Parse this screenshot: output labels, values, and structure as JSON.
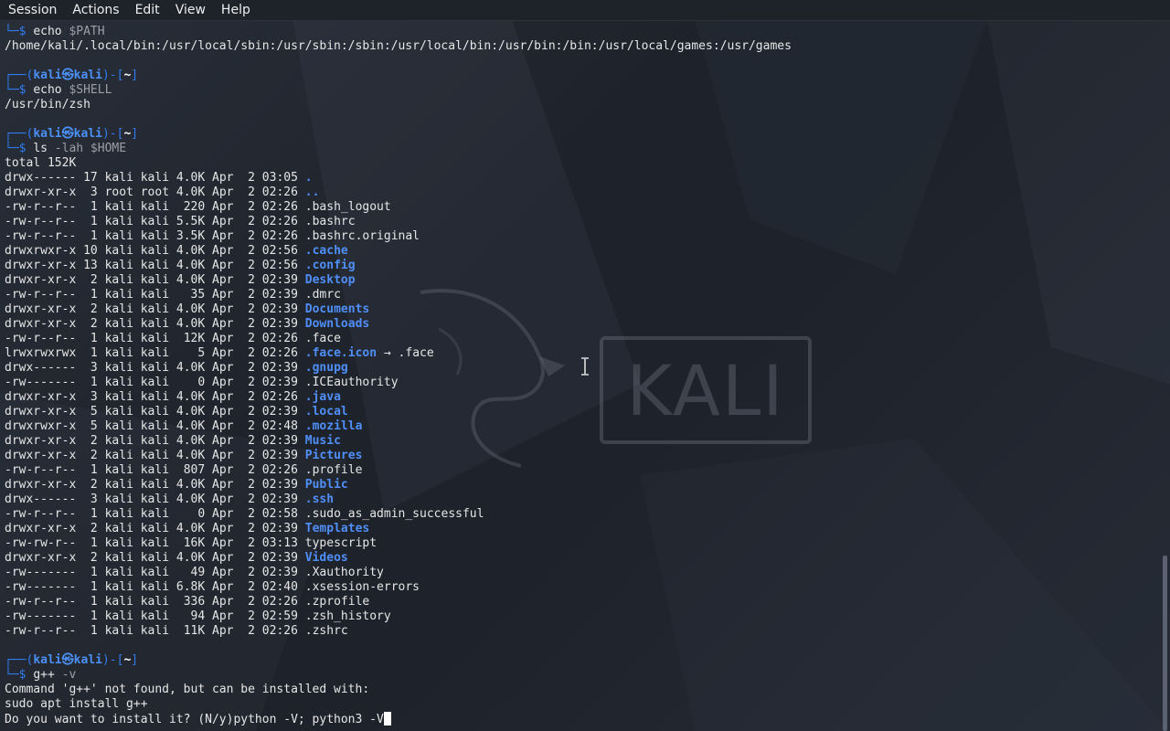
{
  "menubar": {
    "items": [
      "Session",
      "Actions",
      "Edit",
      "View",
      "Help"
    ]
  },
  "background": {
    "logo_text": "KALI"
  },
  "terminal": {
    "prompt": {
      "user": "kali",
      "host": "kali",
      "dir": "~"
    },
    "lines": [
      {
        "kind": "cmdonly",
        "cmd": "echo",
        "args": " $PATH"
      },
      {
        "kind": "out",
        "text": "/home/kali/.local/bin:/usr/local/sbin:/usr/sbin:/sbin:/usr/local/bin:/usr/bin:/bin:/usr/local/games:/usr/games"
      },
      {
        "kind": "blank"
      },
      {
        "kind": "prompt"
      },
      {
        "kind": "cmdonly",
        "cmd": "echo",
        "args": " $SHELL"
      },
      {
        "kind": "out",
        "text": "/usr/bin/zsh"
      },
      {
        "kind": "blank"
      },
      {
        "kind": "prompt"
      },
      {
        "kind": "cmdonly",
        "cmd": "ls",
        "args": " -lah $HOME"
      },
      {
        "kind": "out",
        "text": "total 152K"
      },
      {
        "kind": "ls",
        "perm": "drwx------",
        "links": "17",
        "size": "4.0K",
        "time": "03:05",
        "name": ".",
        "isdir": true
      },
      {
        "kind": "ls",
        "perm": "drwxr-xr-x",
        "links": " 3",
        "owner": "root root",
        "size": "4.0K",
        "time": "02:26",
        "name": "..",
        "isdir": true
      },
      {
        "kind": "ls",
        "perm": "-rw-r--r--",
        "links": " 1",
        "size": " 220",
        "time": "02:26",
        "name": ".bash_logout",
        "isdir": false
      },
      {
        "kind": "ls",
        "perm": "-rw-r--r--",
        "links": " 1",
        "size": "5.5K",
        "time": "02:26",
        "name": ".bashrc",
        "isdir": false
      },
      {
        "kind": "ls",
        "perm": "-rw-r--r--",
        "links": " 1",
        "size": "3.5K",
        "time": "02:26",
        "name": ".bashrc.original",
        "isdir": false
      },
      {
        "kind": "ls",
        "perm": "drwxrwxr-x",
        "links": "10",
        "size": "4.0K",
        "time": "02:56",
        "name": ".cache",
        "isdir": true
      },
      {
        "kind": "ls",
        "perm": "drwxr-xr-x",
        "links": "13",
        "size": "4.0K",
        "time": "02:56",
        "name": ".config",
        "isdir": true
      },
      {
        "kind": "ls",
        "perm": "drwxr-xr-x",
        "links": " 2",
        "size": "4.0K",
        "time": "02:39",
        "name": "Desktop",
        "isdir": true
      },
      {
        "kind": "ls",
        "perm": "-rw-r--r--",
        "links": " 1",
        "size": "  35",
        "time": "02:39",
        "name": ".dmrc",
        "isdir": false
      },
      {
        "kind": "ls",
        "perm": "drwxr-xr-x",
        "links": " 2",
        "size": "4.0K",
        "time": "02:39",
        "name": "Documents",
        "isdir": true
      },
      {
        "kind": "ls",
        "perm": "drwxr-xr-x",
        "links": " 2",
        "size": "4.0K",
        "time": "02:39",
        "name": "Downloads",
        "isdir": true
      },
      {
        "kind": "ls",
        "perm": "-rw-r--r--",
        "links": " 1",
        "size": " 12K",
        "time": "02:26",
        "name": ".face",
        "isdir": false
      },
      {
        "kind": "ls",
        "perm": "lrwxrwxrwx",
        "links": " 1",
        "size": "   5",
        "time": "02:26",
        "name": ".face.icon",
        "isdir": true,
        "link": " → .face"
      },
      {
        "kind": "ls",
        "perm": "drwx------",
        "links": " 3",
        "size": "4.0K",
        "time": "02:39",
        "name": ".gnupg",
        "isdir": true
      },
      {
        "kind": "ls",
        "perm": "-rw-------",
        "links": " 1",
        "size": "   0",
        "time": "02:39",
        "name": ".ICEauthority",
        "isdir": false
      },
      {
        "kind": "ls",
        "perm": "drwxr-xr-x",
        "links": " 3",
        "size": "4.0K",
        "time": "02:26",
        "name": ".java",
        "isdir": true
      },
      {
        "kind": "ls",
        "perm": "drwxr-xr-x",
        "links": " 5",
        "size": "4.0K",
        "time": "02:39",
        "name": ".local",
        "isdir": true
      },
      {
        "kind": "ls",
        "perm": "drwxrwxr-x",
        "links": " 5",
        "size": "4.0K",
        "time": "02:48",
        "name": ".mozilla",
        "isdir": true
      },
      {
        "kind": "ls",
        "perm": "drwxr-xr-x",
        "links": " 2",
        "size": "4.0K",
        "time": "02:39",
        "name": "Music",
        "isdir": true
      },
      {
        "kind": "ls",
        "perm": "drwxr-xr-x",
        "links": " 2",
        "size": "4.0K",
        "time": "02:39",
        "name": "Pictures",
        "isdir": true
      },
      {
        "kind": "ls",
        "perm": "-rw-r--r--",
        "links": " 1",
        "size": " 807",
        "time": "02:26",
        "name": ".profile",
        "isdir": false
      },
      {
        "kind": "ls",
        "perm": "drwxr-xr-x",
        "links": " 2",
        "size": "4.0K",
        "time": "02:39",
        "name": "Public",
        "isdir": true
      },
      {
        "kind": "ls",
        "perm": "drwx------",
        "links": " 3",
        "size": "4.0K",
        "time": "02:39",
        "name": ".ssh",
        "isdir": true
      },
      {
        "kind": "ls",
        "perm": "-rw-r--r--",
        "links": " 1",
        "size": "   0",
        "time": "02:58",
        "name": ".sudo_as_admin_successful",
        "isdir": false
      },
      {
        "kind": "ls",
        "perm": "drwxr-xr-x",
        "links": " 2",
        "size": "4.0K",
        "time": "02:39",
        "name": "Templates",
        "isdir": true
      },
      {
        "kind": "ls",
        "perm": "-rw-rw-r--",
        "links": " 1",
        "size": " 16K",
        "time": "03:13",
        "name": "typescript",
        "isdir": false
      },
      {
        "kind": "ls",
        "perm": "drwxr-xr-x",
        "links": " 2",
        "size": "4.0K",
        "time": "02:39",
        "name": "Videos",
        "isdir": true
      },
      {
        "kind": "ls",
        "perm": "-rw-------",
        "links": " 1",
        "size": "  49",
        "time": "02:39",
        "name": ".Xauthority",
        "isdir": false
      },
      {
        "kind": "ls",
        "perm": "-rw-------",
        "links": " 1",
        "size": "6.8K",
        "time": "02:40",
        "name": ".xsession-errors",
        "isdir": false
      },
      {
        "kind": "ls",
        "perm": "-rw-r--r--",
        "links": " 1",
        "size": " 336",
        "time": "02:26",
        "name": ".zprofile",
        "isdir": false
      },
      {
        "kind": "ls",
        "perm": "-rw-------",
        "links": " 1",
        "size": "  94",
        "time": "02:59",
        "name": ".zsh_history",
        "isdir": false
      },
      {
        "kind": "ls",
        "perm": "-rw-r--r--",
        "links": " 1",
        "size": " 11K",
        "time": "02:26",
        "name": ".zshrc",
        "isdir": false
      },
      {
        "kind": "blank"
      },
      {
        "kind": "prompt"
      },
      {
        "kind": "cmdonly",
        "cmd": "g++",
        "args": " -v"
      },
      {
        "kind": "out",
        "text": "Command 'g++' not found, but can be installed with:"
      },
      {
        "kind": "out",
        "text": "sudo apt install g++"
      },
      {
        "kind": "input",
        "text": "Do you want to install it? (N/y)python -V; python3 -V"
      }
    ],
    "ls_owner_default": "kali kali",
    "ls_month": "Apr",
    "ls_day": " 2"
  }
}
